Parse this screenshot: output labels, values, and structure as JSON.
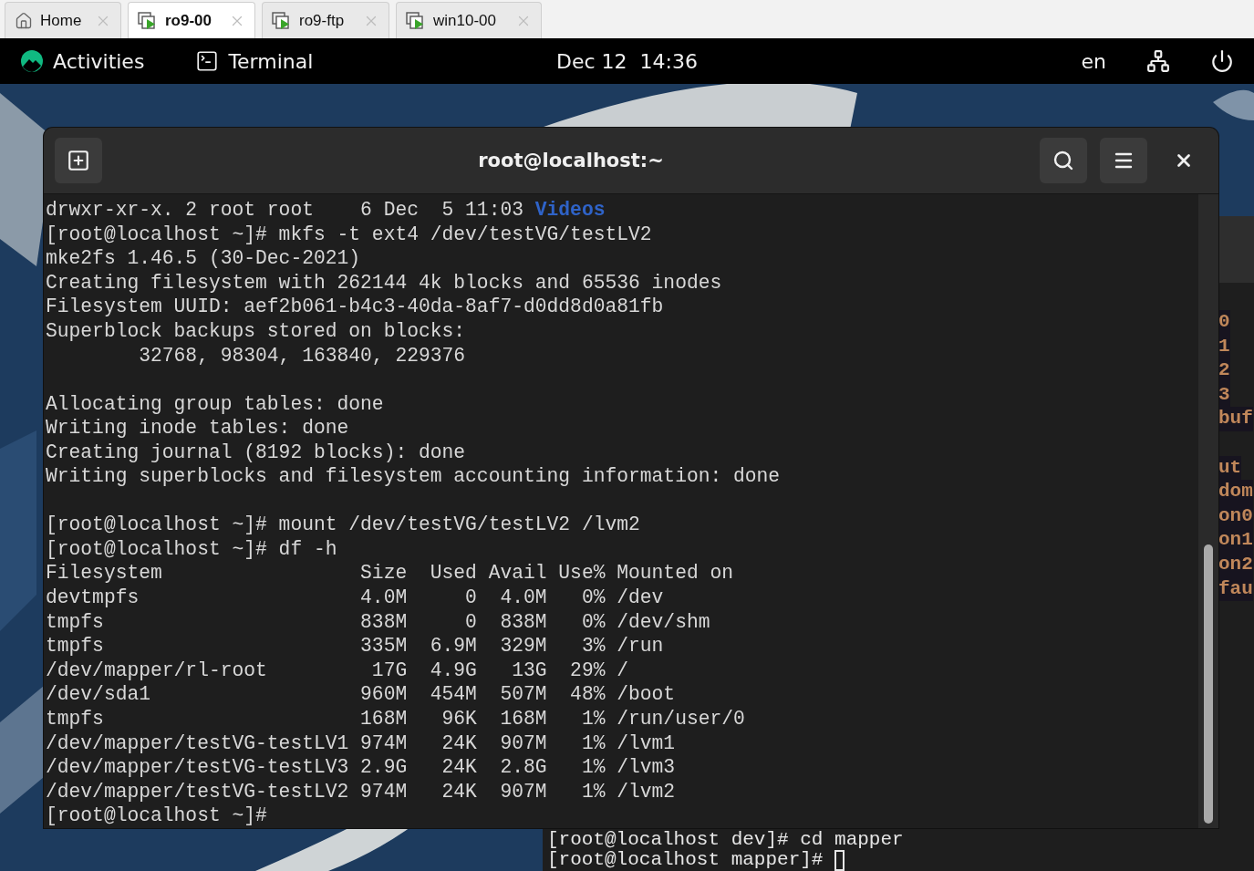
{
  "browser_tabs": [
    {
      "label": "Home",
      "kind": "home",
      "selected": false
    },
    {
      "label": "ro9-00",
      "kind": "vm",
      "selected": true
    },
    {
      "label": "ro9-ftp",
      "kind": "vm",
      "selected": false
    },
    {
      "label": "win10-00",
      "kind": "vm",
      "selected": false
    }
  ],
  "top_bar": {
    "activities": "Activities",
    "app": "Terminal",
    "clock": "Dec 12  14:36",
    "language": "en"
  },
  "terminal": {
    "title": "root@localhost:~",
    "lines": [
      {
        "kind": "listing",
        "text": "drwxr-xr-x. 2 root root    6 Dec  5 11:03 ",
        "name": "Videos"
      },
      {
        "kind": "output",
        "text": "[root@localhost ~]# mkfs -t ext4 /dev/testVG/testLV2"
      },
      {
        "kind": "output",
        "text": "mke2fs 1.46.5 (30-Dec-2021)"
      },
      {
        "kind": "output",
        "text": "Creating filesystem with 262144 4k blocks and 65536 inodes"
      },
      {
        "kind": "output",
        "text": "Filesystem UUID: aef2b061-b4c3-40da-8af7-d0dd8d0a81fb"
      },
      {
        "kind": "output",
        "text": "Superblock backups stored on blocks:"
      },
      {
        "kind": "output",
        "text": "        32768, 98304, 163840, 229376"
      },
      {
        "kind": "blank"
      },
      {
        "kind": "output",
        "text": "Allocating group tables: done"
      },
      {
        "kind": "output",
        "text": "Writing inode tables: done"
      },
      {
        "kind": "output",
        "text": "Creating journal (8192 blocks): done"
      },
      {
        "kind": "output",
        "text": "Writing superblocks and filesystem accounting information: done"
      },
      {
        "kind": "blank"
      },
      {
        "kind": "output",
        "text": "[root@localhost ~]# mount /dev/testVG/testLV2 /lvm2"
      },
      {
        "kind": "output",
        "text": "[root@localhost ~]# df -h"
      },
      {
        "kind": "output",
        "text": "Filesystem                 Size  Used Avail Use% Mounted on"
      },
      {
        "kind": "output",
        "text": "devtmpfs                   4.0M     0  4.0M   0% /dev"
      },
      {
        "kind": "output",
        "text": "tmpfs                      838M     0  838M   0% /dev/shm"
      },
      {
        "kind": "output",
        "text": "tmpfs                      335M  6.9M  329M   3% /run"
      },
      {
        "kind": "output",
        "text": "/dev/mapper/rl-root         17G  4.9G   13G  29% /"
      },
      {
        "kind": "output",
        "text": "/dev/sda1                  960M  454M  507M  48% /boot"
      },
      {
        "kind": "output",
        "text": "tmpfs                      168M   96K  168M   1% /run/user/0"
      },
      {
        "kind": "output",
        "text": "/dev/mapper/testVG-testLV1 974M   24K  907M   1% /lvm1"
      },
      {
        "kind": "output",
        "text": "/dev/mapper/testVG-testLV3 2.9G   24K  2.8G   1% /lvm3"
      },
      {
        "kind": "output",
        "text": "/dev/mapper/testVG-testLV2 974M   24K  907M   1% /lvm2"
      },
      {
        "kind": "output",
        "text": "[root@localhost ~]# "
      }
    ]
  },
  "background_terminal": {
    "side_fragments": [
      {
        "kind": "text",
        "text": "0"
      },
      {
        "kind": "text",
        "text": "1"
      },
      {
        "kind": "text",
        "text": "2"
      },
      {
        "kind": "text",
        "text": "3"
      },
      {
        "kind": "text",
        "text": "buf"
      },
      {
        "kind": "blank"
      },
      {
        "kind": "text",
        "text": "ut"
      },
      {
        "kind": "text",
        "text": "dom"
      },
      {
        "kind": "text",
        "text": "on0"
      },
      {
        "kind": "text",
        "text": "on1"
      },
      {
        "kind": "text",
        "text": "on2"
      },
      {
        "kind": "text",
        "text": "fau"
      }
    ],
    "lines": [
      {
        "text": "[root@localhost dev]# cd mapper",
        "cursor": false
      },
      {
        "text": "[root@localhost mapper]# ",
        "cursor": true
      }
    ]
  }
}
